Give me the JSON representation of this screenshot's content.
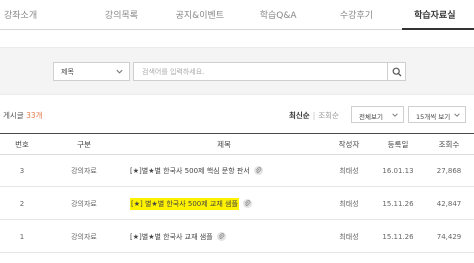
{
  "tabs": [
    {
      "label": "강좌소개"
    },
    {
      "label": "강의목록"
    },
    {
      "label": "공지&이벤트"
    },
    {
      "label": "학습Q&A"
    },
    {
      "label": "수강후기"
    },
    {
      "label": "학습자료실"
    }
  ],
  "search": {
    "select_value": "제목",
    "placeholder": "검색어를 입력하세요."
  },
  "summary": {
    "label": "게시글",
    "count": "33개"
  },
  "sort": {
    "latest": "최신순",
    "separator": "|",
    "views": "조회순"
  },
  "filters": {
    "view_all": "전체보기",
    "page_size": "15개씩 보기"
  },
  "table": {
    "headers": {
      "no": "번호",
      "category": "구분",
      "title": "제목",
      "author": "작성자",
      "date": "등록일",
      "views": "조회수"
    },
    "rows": [
      {
        "no": "3",
        "category": "강의자료",
        "prefix": "[★]",
        "title": " 별★별 한국사 500제 핵심 문항 판서",
        "highlight": false,
        "author": "최태성",
        "date": "16.01.13",
        "views": "27,868"
      },
      {
        "no": "2",
        "category": "강의자료",
        "prefix": "[★]",
        "title": " 별★별 한국사 500제 교재 샘플",
        "highlight": true,
        "author": "최태성",
        "date": "15.11.26",
        "views": "42,847"
      },
      {
        "no": "1",
        "category": "강의자료",
        "prefix": "[★]",
        "title": " 별★별 한국사 교재 샘플",
        "highlight": false,
        "author": "최태성",
        "date": "15.11.26",
        "views": "74,429"
      }
    ]
  },
  "colors": {
    "accent_count": "#e67b4e",
    "highlight": "#fff200"
  },
  "icons": {
    "search": "search-icon",
    "chevron": "chevron-down-icon",
    "attachment": "attachment-icon"
  }
}
